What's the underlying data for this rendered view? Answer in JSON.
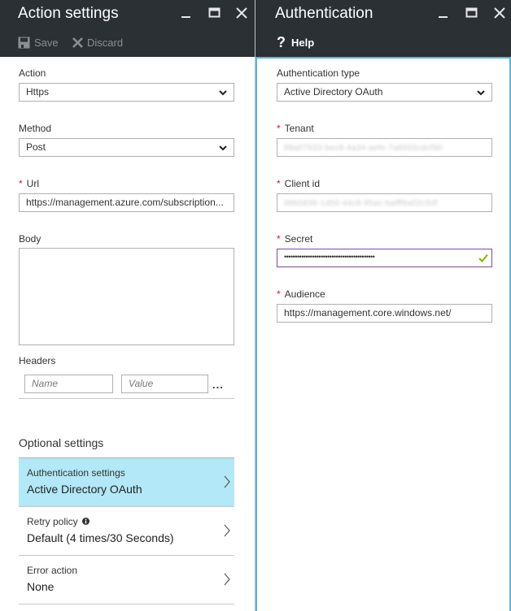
{
  "left_pane": {
    "title": "Action settings",
    "window_controls": [
      "minimize",
      "maximize",
      "close"
    ],
    "toolbar": {
      "save_label": "Save",
      "discard_label": "Discard"
    },
    "fields": {
      "action": {
        "label": "Action",
        "value": "Https"
      },
      "method": {
        "label": "Method",
        "value": "Post"
      },
      "url": {
        "label": "Url",
        "required_mark": "*",
        "value": "https://management.azure.com/subscription..."
      },
      "body": {
        "label": "Body",
        "value": ""
      },
      "headers": {
        "label": "Headers",
        "name_placeholder": "Name",
        "value_placeholder": "Value",
        "more": "..."
      }
    },
    "optional_settings": {
      "heading": "Optional settings",
      "items": [
        {
          "label": "Authentication settings",
          "value": "Active Directory OAuth",
          "selected": true
        },
        {
          "label": "Retry policy",
          "value": "Default (4 times/30 Seconds)",
          "info_icon": true
        },
        {
          "label": "Error action",
          "value": "None"
        }
      ]
    }
  },
  "right_pane": {
    "title": "Authentication",
    "toolbar": {
      "help_label": "Help"
    },
    "fields": {
      "auth_type": {
        "label": "Authentication type",
        "value": "Active Directory OAuth"
      },
      "tenant": {
        "label": "Tenant",
        "required_mark": "*",
        "value": "89a07933-bec8-4a34-aefe-7a6655cdcf90"
      },
      "client_id": {
        "label": "Client id",
        "required_mark": "*",
        "value": "98b5836-1d56-44c8-95ac-bafff8a02c5df"
      },
      "secret": {
        "label": "Secret",
        "required_mark": "*",
        "value": "••••••••••••••••••••••••••••••••••••••••••"
      },
      "audience": {
        "label": "Audience",
        "required_mark": "*",
        "value": "https://management.core.windows.net/"
      }
    }
  },
  "colors": {
    "titlebar_bg": "#2b3035",
    "selected_item_bg": "#b2e8f7",
    "active_pane_border": "#59b4d9",
    "secret_border": "#804998",
    "valid_check": "#7fba00",
    "required_star": "#e81123"
  }
}
